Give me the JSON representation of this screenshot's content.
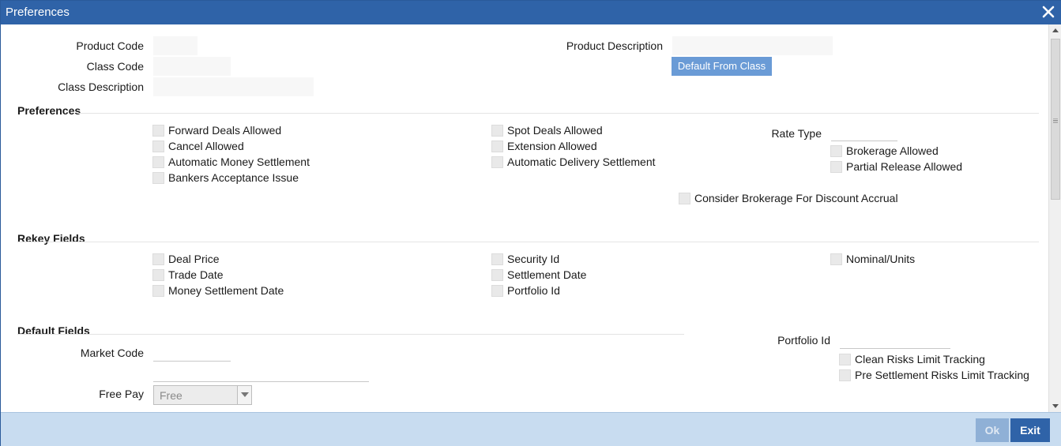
{
  "window": {
    "title": "Preferences"
  },
  "header_fields": {
    "product_code_label": "Product Code",
    "class_code_label": "Class Code",
    "class_description_label": "Class Description",
    "product_description_label": "Product Description",
    "default_from_class_label": "Default From Class"
  },
  "preferences": {
    "heading": "Preferences",
    "forward_deals_allowed": "Forward Deals Allowed",
    "cancel_allowed": "Cancel Allowed",
    "automatic_money_settlement": "Automatic Money Settlement",
    "bankers_acceptance_issue": "Bankers Acceptance Issue",
    "spot_deals_allowed": "Spot Deals Allowed",
    "extension_allowed": "Extension Allowed",
    "automatic_delivery_settlement": "Automatic Delivery Settlement",
    "rate_type_label": "Rate Type",
    "brokerage_allowed": "Brokerage Allowed",
    "partial_release_allowed": "Partial Release Allowed",
    "consider_brokerage": "Consider Brokerage For Discount Accrual"
  },
  "rekey_fields": {
    "heading": "Rekey Fields",
    "deal_price": "Deal Price",
    "trade_date": "Trade Date",
    "money_settlement_date": "Money Settlement Date",
    "security_id": "Security Id",
    "settlement_date": "Settlement Date",
    "portfolio_id": "Portfolio Id",
    "nominal_units": "Nominal/Units"
  },
  "default_fields": {
    "heading": "Default Fields",
    "market_code_label": "Market Code",
    "free_pay_label": "Free Pay",
    "free_pay_value": "Free",
    "portfolio_id_label": "Portfolio Id",
    "clean_risks": "Clean Risks Limit Tracking",
    "pre_settlement_risks": "Pre Settlement Risks Limit Tracking"
  },
  "footer": {
    "ok_label": "Ok",
    "exit_label": "Exit"
  },
  "icons": {
    "close": "close-icon",
    "dropdown": "chevron-down-icon",
    "scroll_up": "arrow-up-icon",
    "scroll_down": "arrow-down-icon"
  },
  "colors": {
    "titlebar": "#2f63a8",
    "footer": "#c8dcf0",
    "button": "#6a9bd6"
  }
}
